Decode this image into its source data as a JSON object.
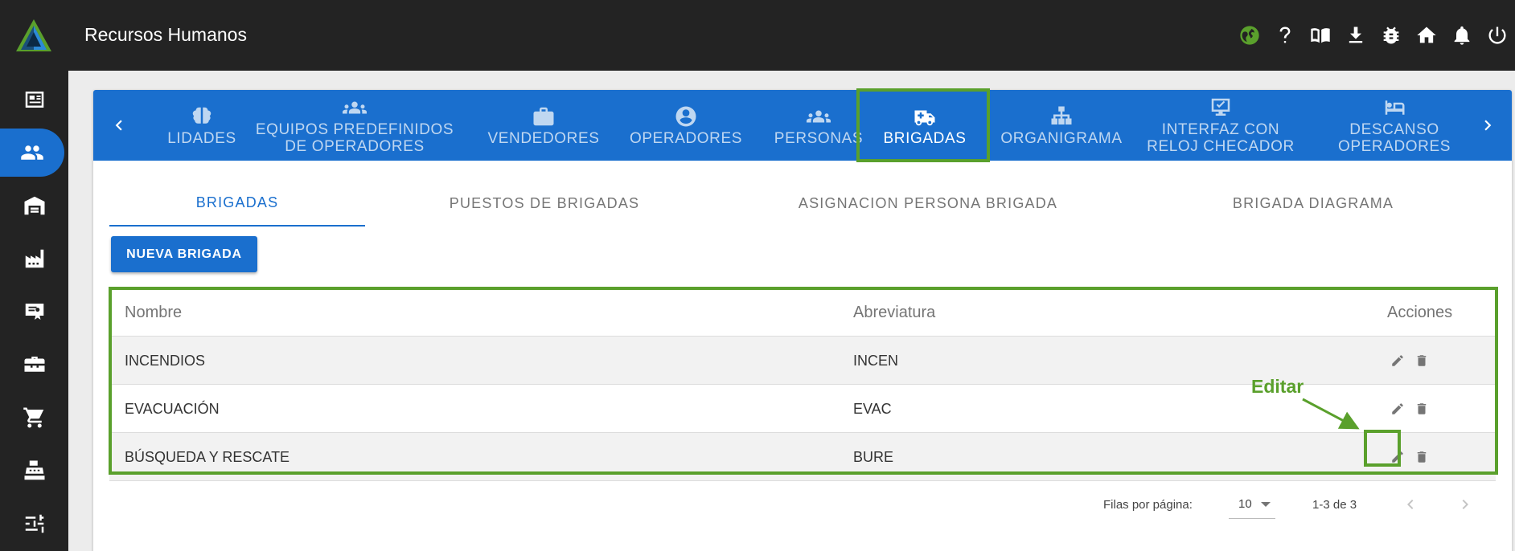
{
  "app": {
    "title": "Recursos Humanos"
  },
  "topbar": {
    "icons": [
      "globe-icon",
      "help-icon",
      "book-icon",
      "download-icon",
      "bug-icon",
      "home-icon",
      "bell-icon",
      "power-icon"
    ],
    "globe_color": "#5aa02c"
  },
  "sidebar": {
    "items": [
      "newspaper-icon",
      "people-icon",
      "warehouse-icon",
      "factory-icon",
      "certificate-icon",
      "toolbox-icon",
      "cart-icon",
      "register-icon",
      "sliders-icon"
    ],
    "active_index": 1
  },
  "nav_tabs": {
    "items": [
      {
        "label_lines": [
          "LIDADES"
        ],
        "icon": "brain-icon"
      },
      {
        "label_lines": [
          "EQUIPOS PREDEFINIDOS",
          "DE OPERADORES"
        ],
        "icon": "group-icon"
      },
      {
        "label_lines": [
          "VENDEDORES"
        ],
        "icon": "briefcase-icon"
      },
      {
        "label_lines": [
          "OPERADORES"
        ],
        "icon": "account-circle-icon"
      },
      {
        "label_lines": [
          "PERSONAS"
        ],
        "icon": "group-icon"
      },
      {
        "label_lines": [
          "BRIGADAS"
        ],
        "icon": "ambulance-icon"
      },
      {
        "label_lines": [
          "ORGANIGRAMA"
        ],
        "icon": "sitemap-icon"
      },
      {
        "label_lines": [
          "INTERFAZ CON",
          "RELOJ CHECADOR"
        ],
        "icon": "monitor-check-icon"
      },
      {
        "label_lines": [
          "DESCANSO",
          "OPERADORES"
        ],
        "icon": "bed-icon"
      }
    ],
    "active": "BRIGADAS"
  },
  "sub_tabs": {
    "items": [
      "BRIGADAS",
      "PUESTOS DE BRIGADAS",
      "ASIGNACION PERSONA BRIGADA",
      "BRIGADA DIAGRAMA"
    ],
    "active": "BRIGADAS"
  },
  "new_button": "NUEVA BRIGADA",
  "table": {
    "headers": [
      "Nombre",
      "Abreviatura",
      "Acciones"
    ],
    "rows": [
      {
        "nombre": "INCENDIOS",
        "abreviatura": "INCEN"
      },
      {
        "nombre": "EVACUACIÓN",
        "abreviatura": "EVAC"
      },
      {
        "nombre": "BÚSQUEDA Y RESCATE",
        "abreviatura": "BURE"
      }
    ],
    "action_icons": [
      "pencil-icon",
      "trash-icon"
    ]
  },
  "pagination": {
    "rows_per_page_label": "Filas por página:",
    "rows_per_page": "10",
    "range": "1-3 de 3"
  },
  "annotation": {
    "text": "Editar",
    "color": "#5aa02c"
  },
  "colors": {
    "primary": "#1a6fce",
    "topbar": "#232323",
    "highlight": "#5aa02c"
  }
}
